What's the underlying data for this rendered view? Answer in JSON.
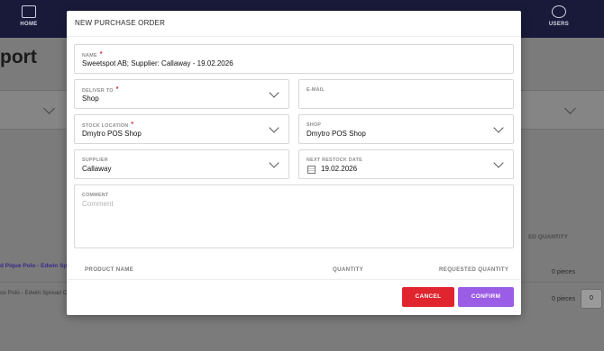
{
  "nav": {
    "home_label": "HOME",
    "users_label": "USERS"
  },
  "background": {
    "page_title_fragment": "port",
    "row1_text": "d Pique Polo - Edwin Spre",
    "row2_text": "ce Polo - Edwin Spread C",
    "requested_quantity_header": "ED QUANTITY",
    "row1_pieces": "0 pieces",
    "row2_pieces": "0 pieces",
    "row2_qty_value": "0"
  },
  "modal": {
    "title": "NEW PURCHASE ORDER",
    "fields": {
      "name": {
        "label": "NAME",
        "value": "Sweetspot AB; Supplier: Callaway - 19.02.2026",
        "required": true
      },
      "deliver_to": {
        "label": "DELIVER TO",
        "value": "Shop",
        "required": true
      },
      "email": {
        "label": "E-MAIL",
        "value": ""
      },
      "stock_location": {
        "label": "STOCK LOCATION",
        "value": "Dmytro POS Shop",
        "required": true
      },
      "shop": {
        "label": "SHOP",
        "value": "Dmytro POS Shop"
      },
      "supplier": {
        "label": "SUPPLIER",
        "value": "Callaway"
      },
      "next_restock_date": {
        "label": "NEXT RESTOCK DATE",
        "value": "19.02.2026"
      },
      "comment": {
        "label": "COMMENT",
        "placeholder": "Comment",
        "value": ""
      }
    },
    "required_marker": "*",
    "table_headers": {
      "product_name": "PRODUCT NAME",
      "quantity": "QUANTITY",
      "requested_quantity": "REQUESTED QUANTITY"
    },
    "buttons": {
      "cancel": "CANCEL",
      "confirm": "CONFIRM"
    }
  },
  "colors": {
    "nav_bg": "#191a3a",
    "cancel": "#e0252f",
    "confirm": "#9b5de5",
    "required": "#d0202a"
  }
}
